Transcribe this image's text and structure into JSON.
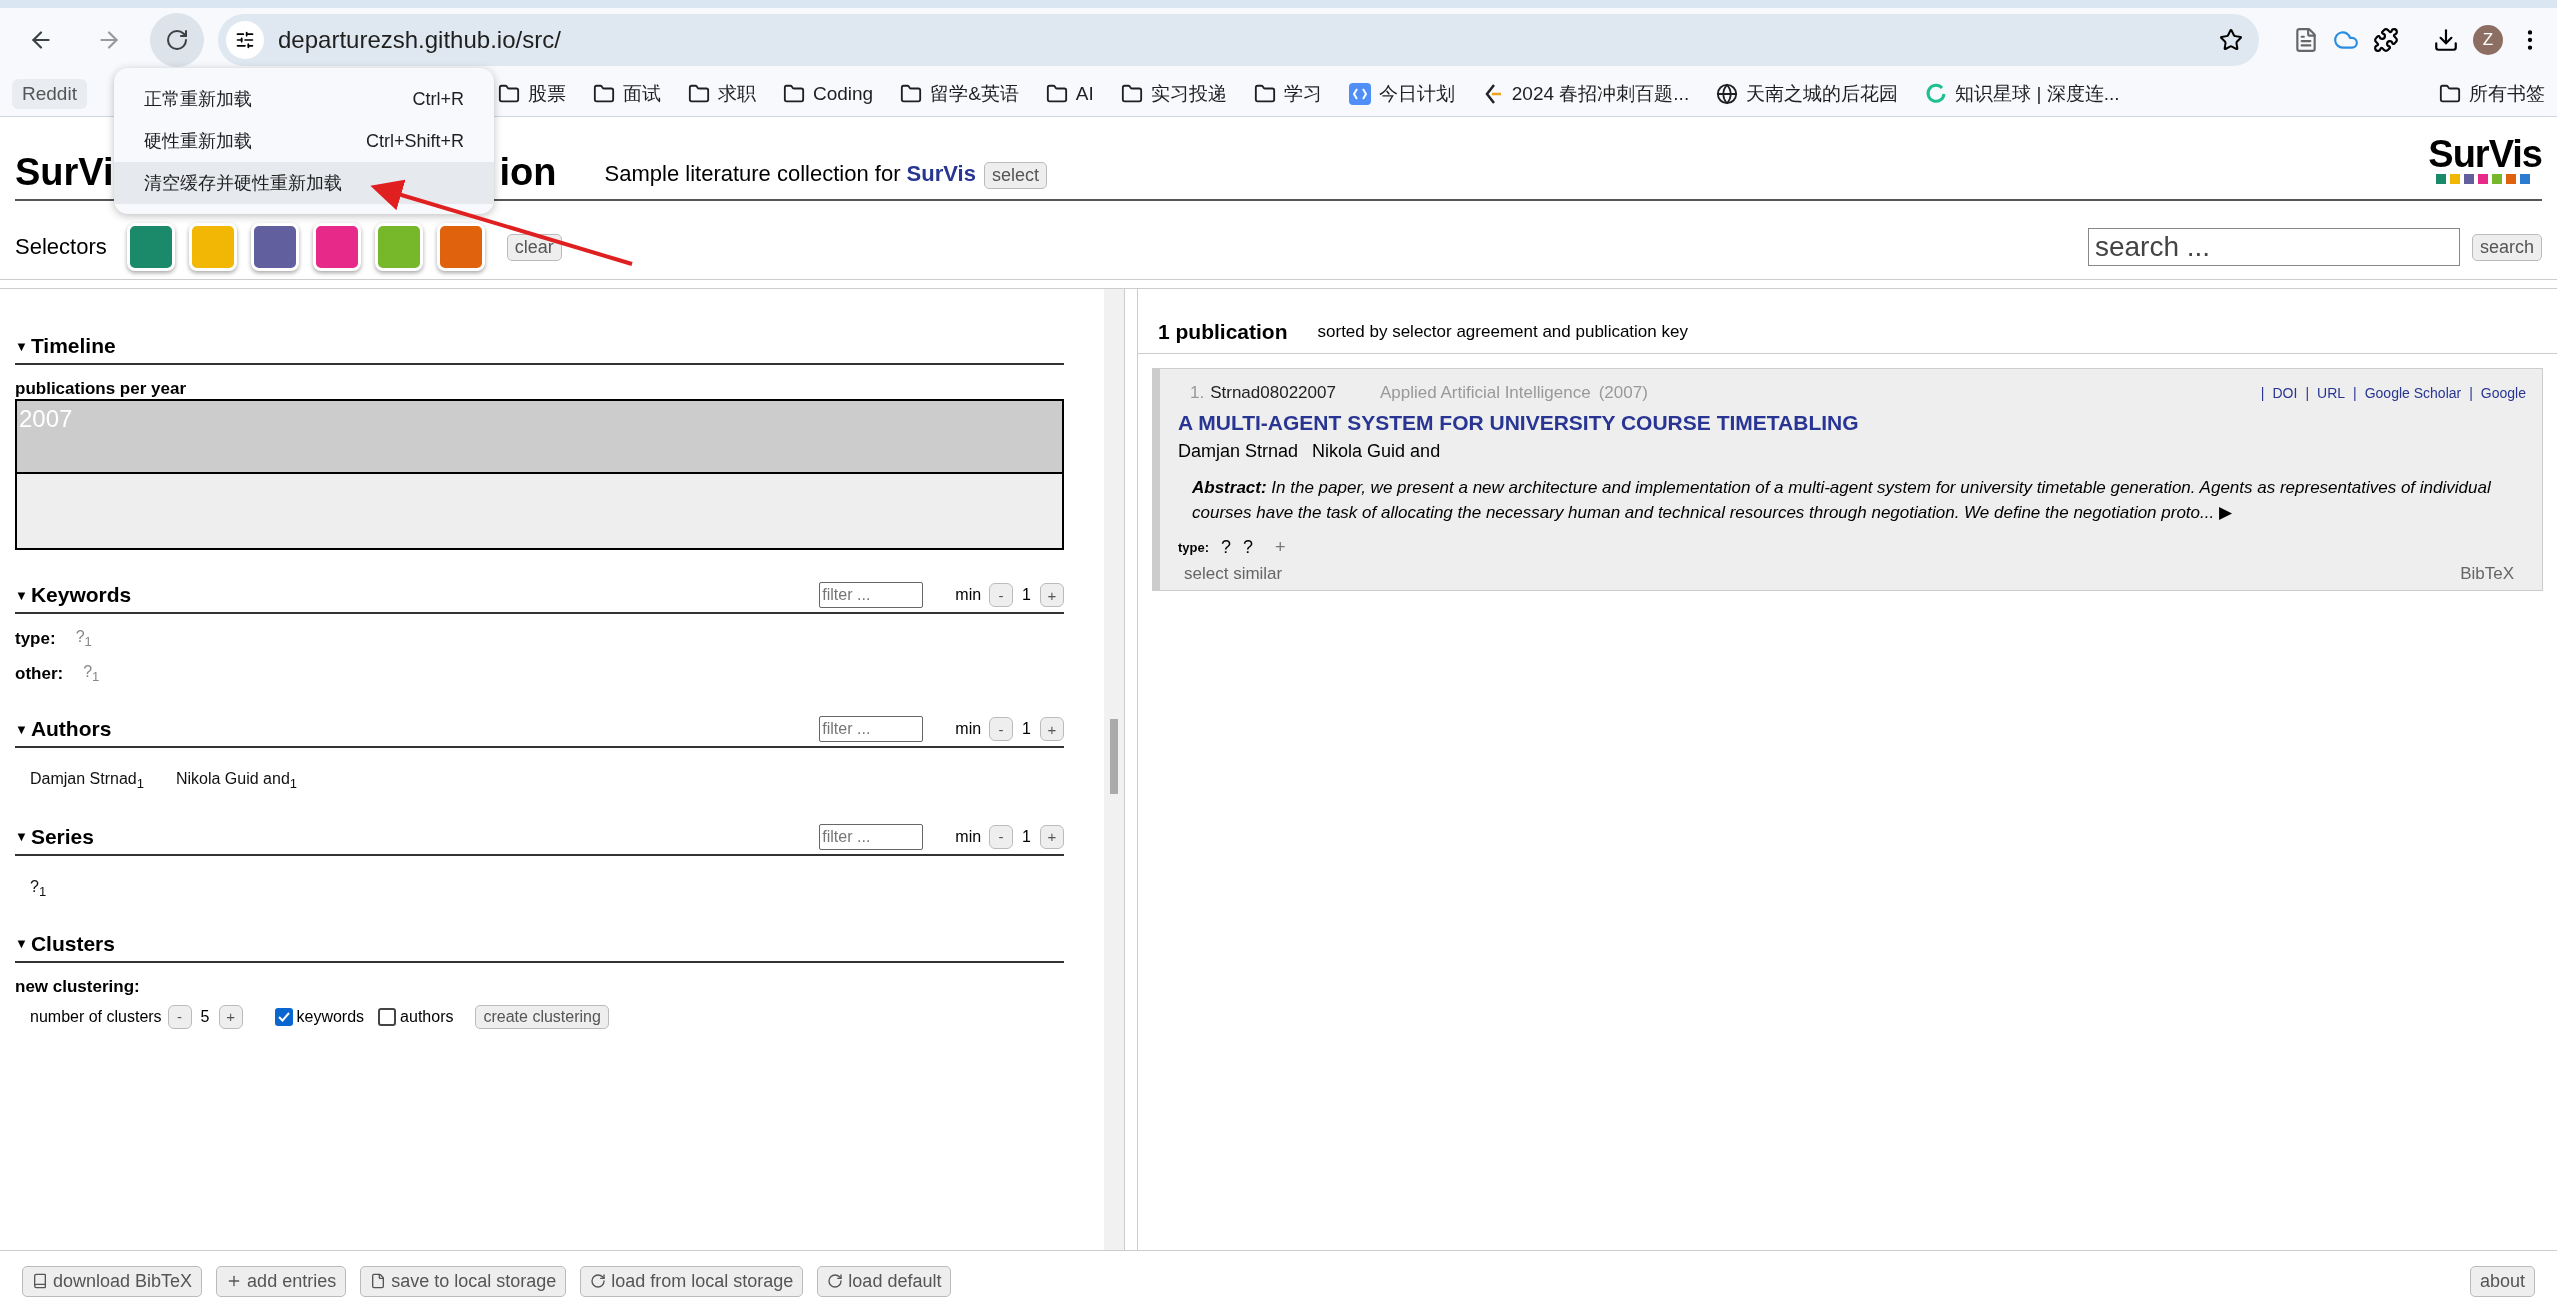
{
  "browser": {
    "url": "departurezsh.github.io/src/",
    "bookmarks": [
      {
        "label": "Reddit",
        "kind": "plain"
      },
      {
        "label": "股票",
        "kind": "folder"
      },
      {
        "label": "面试",
        "kind": "folder"
      },
      {
        "label": "求职",
        "kind": "folder"
      },
      {
        "label": "Coding",
        "kind": "folder"
      },
      {
        "label": "留学&英语",
        "kind": "folder"
      },
      {
        "label": "AI",
        "kind": "folder"
      },
      {
        "label": "实习投递",
        "kind": "folder"
      },
      {
        "label": "学习",
        "kind": "folder"
      },
      {
        "label": "今日计划",
        "kind": "app"
      },
      {
        "label": "2024 春招冲刺百题...",
        "kind": "code"
      },
      {
        "label": "天南之城的后花园",
        "kind": "globe"
      },
      {
        "label": "知识星球 | 深度连...",
        "kind": "ring"
      }
    ],
    "all_bookmarks": "所有书签",
    "avatar": "Z",
    "menu": [
      {
        "label": "正常重新加载",
        "shortcut": "Ctrl+R",
        "selected": false
      },
      {
        "label": "硬性重新加载",
        "shortcut": "Ctrl+Shift+R",
        "selected": false
      },
      {
        "label": "清空缓存并硬性重新加载",
        "selected": true
      }
    ]
  },
  "header": {
    "title_parts": [
      "SurVi",
      "ion"
    ],
    "subtitle": "Sample literature collection for **SurVis**",
    "select_button": "select",
    "logo": "SurVis"
  },
  "selectors": {
    "label": "Selectors",
    "colors": [
      {
        "color": "#1b8a6b"
      },
      {
        "color": "#f2b705"
      },
      {
        "color": "#625f9e"
      },
      {
        "color": "#e7298a"
      },
      {
        "color": "#76b82a"
      },
      {
        "color": "#e0620d"
      }
    ],
    "clear": "clear"
  },
  "search": {
    "placeholder": "search ...",
    "button": "search"
  },
  "timeline": {
    "caret": "▼",
    "title": "Timeline",
    "label": "publications per year",
    "year": "2007"
  },
  "keywords": {
    "caret": "▼",
    "title": "Keywords",
    "filter_placeholder": "filter ...",
    "min_label": "min",
    "min_value": "1",
    "minus": "-",
    "plus": "+",
    "rows": [
      {
        "label": "type:",
        "tag": "?",
        "count": "1"
      },
      {
        "label": "other:",
        "tag": "?",
        "count": "1"
      }
    ]
  },
  "authors": {
    "caret": "▼",
    "title": "Authors",
    "filter_placeholder": "filter ...",
    "min_label": "min",
    "min_value": "1",
    "minus": "-",
    "plus": "+",
    "tags": [
      {
        "name": "Damjan Strnad",
        "count": "1"
      },
      {
        "name": "Nikola Guid and",
        "count": "1"
      }
    ]
  },
  "series": {
    "caret": "▼",
    "title": "Series",
    "filter_placeholder": "filter ...",
    "min_label": "min",
    "min_value": "1",
    "minus": "-",
    "plus": "+",
    "tags": [
      {
        "name": "?",
        "count": "1"
      }
    ]
  },
  "clusters": {
    "caret": "▼",
    "title": "Clusters",
    "subtitle": "new clustering:",
    "count_label": "number of clusters",
    "minus": "-",
    "count": "5",
    "plus": "+",
    "options": [
      {
        "label": "keywords",
        "checked": true
      },
      {
        "label": "authors",
        "checked": false
      }
    ],
    "create": "create clustering"
  },
  "results": {
    "count": "1 publication",
    "sort": "sorted by selector agreement and publication key",
    "publications": [
      {
        "index": "1.",
        "key": "Strnad08022007",
        "venue": "Applied Artificial Intelligence",
        "year": "(2007)",
        "links": [
          {
            "separator": "|",
            "label": "DOI"
          },
          {
            "separator": "|",
            "label": "URL"
          },
          {
            "separator": "|",
            "label": "Google Scholar"
          },
          {
            "separator": "|",
            "label": "Google"
          }
        ],
        "title": "A MULTI-AGENT SYSTEM FOR UNIVERSITY COURSE TIMETABLING",
        "authors": [
          "Damjan Strnad",
          "Nikola Guid and"
        ],
        "abstract_label": "Abstract:",
        "abstract": "In the paper, we present a new architecture and implementation of a multi-agent system for university timetable generation. Agents as representatives of individual courses have the task of allocating the necessary human and technical resources through negotiation. We define the negotiation proto...",
        "more": "▶",
        "type_label": "type:",
        "tags": [
          "?",
          "?"
        ],
        "add": "+",
        "select_similar": "select similar",
        "bibtex": "BibTeX"
      }
    ]
  },
  "footer": {
    "buttons": [
      {
        "label": "download BibTeX",
        "kind": "book"
      },
      {
        "label": "add entries",
        "kind": "plus"
      },
      {
        "label": "save to local storage",
        "kind": "file"
      },
      {
        "label": "load from local storage",
        "kind": "reload"
      },
      {
        "label": "load default",
        "kind": "reload"
      }
    ],
    "about": "about"
  }
}
